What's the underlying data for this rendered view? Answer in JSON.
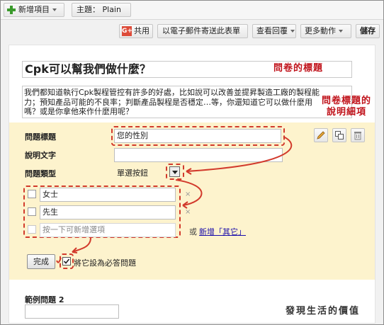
{
  "topbar": {
    "add_item": "新增項目",
    "theme_label": "主題：",
    "theme_value": "Plain"
  },
  "toolbar": {
    "share": "共用",
    "gplus": "G+",
    "email_form": "以電子郵件寄送此表單",
    "view_responses": "查看回覆",
    "more_actions": "更多動作",
    "save": "儲存"
  },
  "form": {
    "title": "Cpk可以幫我們做什麼？",
    "description_lines": [
      "我們都知道執行Cpk製程管控有許多的好處，比如說可以改善並提昇製造工廠的製程能",
      "力；預知產品可能的不良率；判斷產品製程是否穩定…等，你還知道它可以做什麼用",
      "嗎？或是你拿他來作什麼用呢？"
    ]
  },
  "question": {
    "title_label": "問題標題",
    "title_value": "您的性別",
    "help_label": "說明文字",
    "type_label": "問題類型",
    "type_value": "單選按鈕",
    "options": [
      "女士",
      "先生"
    ],
    "add_option_placeholder": "按一下可新增選項",
    "or_text": "或",
    "add_other_link": "新增「其它」",
    "remove_mark": "×",
    "done_button": "完成",
    "required_label": "將它設為必答問題",
    "required_checked": true
  },
  "example": {
    "label": "範例問題 2"
  },
  "annotations": {
    "form_title_note": "問卷的標題",
    "description_note_line1": "問卷標題的",
    "description_note_line2": "說明細項"
  },
  "watermark": "發現生活的價值",
  "colors": {
    "annotation_red": "#c0121a",
    "editing_bg": "#fdf3cd",
    "link_blue": "#1a0dab"
  }
}
